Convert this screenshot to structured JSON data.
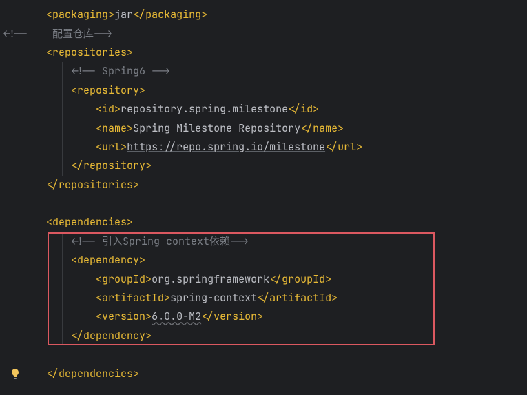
{
  "code": {
    "lines": [
      {
        "indent": 1,
        "type": "tag",
        "tag": "packaging",
        "content": "jar",
        "close": true
      },
      {
        "indent": 0,
        "type": "comment",
        "text": "<!--    配置仓库-->"
      },
      {
        "indent": 1,
        "type": "open",
        "tag": "repositories"
      },
      {
        "indent": 2,
        "type": "comment",
        "text": "<!-- Spring6 -->"
      },
      {
        "indent": 2,
        "type": "open",
        "tag": "repository"
      },
      {
        "indent": 3,
        "type": "tag",
        "tag": "id",
        "content": "repository.spring.milestone",
        "close": true
      },
      {
        "indent": 3,
        "type": "tag",
        "tag": "name",
        "content": "Spring Milestone Repository",
        "close": true
      },
      {
        "indent": 3,
        "type": "tag-url",
        "tag": "url",
        "content": "https://repo.spring.io/milestone",
        "close": true
      },
      {
        "indent": 2,
        "type": "close",
        "tag": "repository"
      },
      {
        "indent": 1,
        "type": "close",
        "tag": "repositories"
      },
      {
        "indent": 0,
        "type": "blank"
      },
      {
        "indent": 1,
        "type": "open",
        "tag": "dependencies"
      },
      {
        "indent": 2,
        "type": "comment",
        "text": "<!-- 引入Spring context依赖-->"
      },
      {
        "indent": 2,
        "type": "open",
        "tag": "dependency"
      },
      {
        "indent": 3,
        "type": "tag",
        "tag": "groupId",
        "content": "org.springframework",
        "close": true
      },
      {
        "indent": 3,
        "type": "tag",
        "tag": "artifactId",
        "content": "spring-context",
        "close": true
      },
      {
        "indent": 3,
        "type": "tag-wavy",
        "tag": "version",
        "content": "6.0.0-M2",
        "close": true
      },
      {
        "indent": 2,
        "type": "close",
        "tag": "dependency"
      },
      {
        "indent": 0,
        "type": "blank"
      },
      {
        "indent": 1,
        "type": "close",
        "tag": "dependencies"
      }
    ]
  },
  "gutter": {
    "bulb_icon": "lightbulb"
  }
}
